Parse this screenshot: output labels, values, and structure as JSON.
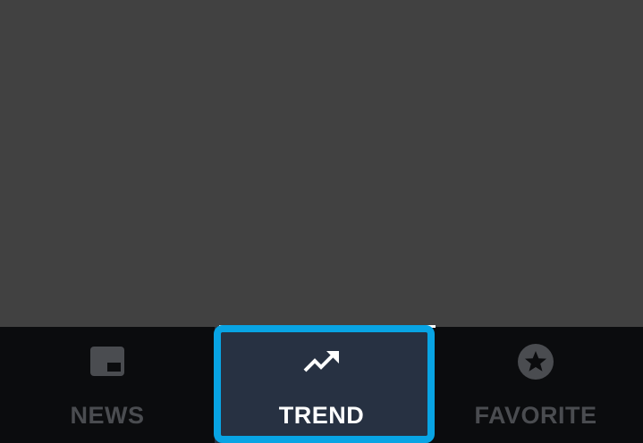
{
  "bottom_nav": {
    "tabs": [
      {
        "label": "NEWS",
        "icon": "picture-in-picture-icon",
        "selected": false
      },
      {
        "label": "TREND",
        "icon": "trending-up-icon",
        "selected": true
      },
      {
        "label": "FAVORITE",
        "icon": "star-circle-icon",
        "selected": false
      }
    ]
  },
  "colors": {
    "content_background": "#414141",
    "nav_background": "#0b0c0e",
    "selected_tab_background": "#273142",
    "focus_ring": "#08a4e4",
    "inactive_label": "#4a4c50",
    "active_label": "#ffffff"
  }
}
